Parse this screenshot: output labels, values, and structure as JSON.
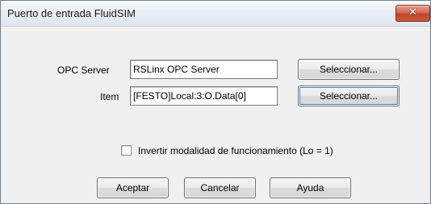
{
  "window": {
    "title": "Puerto de entrada FluidSIM",
    "close_glyph": "✕"
  },
  "form": {
    "opc_server_label": "OPC Server",
    "opc_server_value": "RSLinx OPC Server",
    "item_label": "Item",
    "item_value": "[FESTO]Local:3:O.Data[0]",
    "select_server_label": "Seleccionar...",
    "select_item_label": "Seleccionar..."
  },
  "options": {
    "invert_label": "Invertir modalidad de funcionamiento (Lo = 1)",
    "invert_checked": false
  },
  "buttons": {
    "accept": "Aceptar",
    "cancel": "Cancelar",
    "help": "Ayuda"
  }
}
